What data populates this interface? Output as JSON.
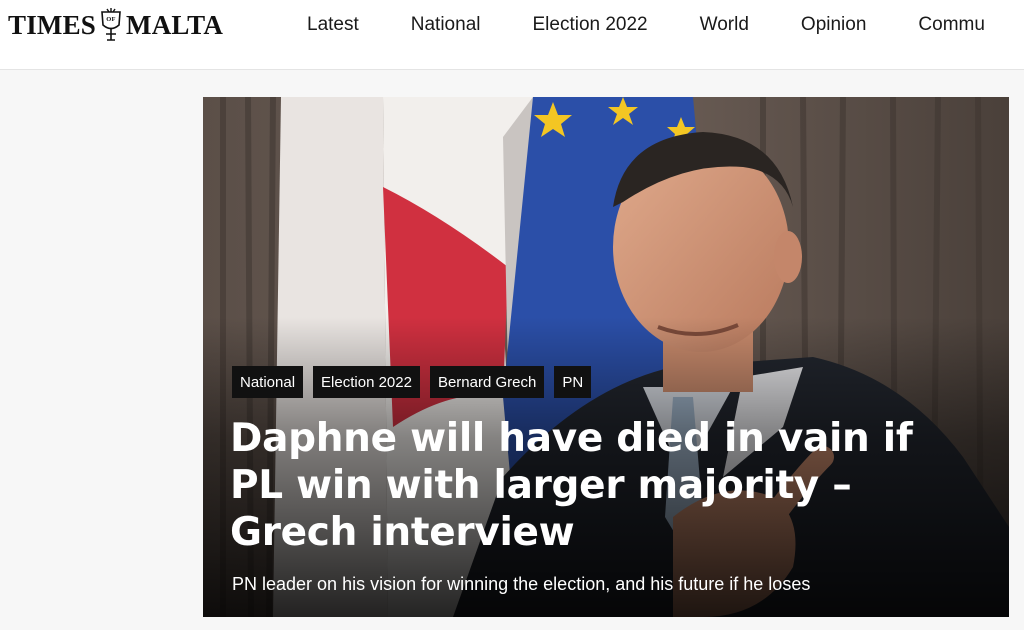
{
  "header": {
    "logo_left": "TIMES",
    "logo_right": "MALTA",
    "crest_text": "OF",
    "nav": [
      "Latest",
      "National",
      "Election 2022",
      "World",
      "Opinion",
      "Commu"
    ]
  },
  "hero": {
    "tags": [
      "National",
      "Election 2022",
      "Bernard Grech",
      "PN"
    ],
    "headline": "Daphne will have died in vain if PL win with larger majority – Grech interview",
    "standfirst": "PN leader on his vision for winning the election, and his future if he loses",
    "image_icon": "photo-of-man-in-suit-before-malta-and-eu-flags"
  },
  "colors": {
    "flag_red": "#d03040",
    "eu_blue": "#2b4fa8",
    "eu_star": "#f3c623"
  }
}
